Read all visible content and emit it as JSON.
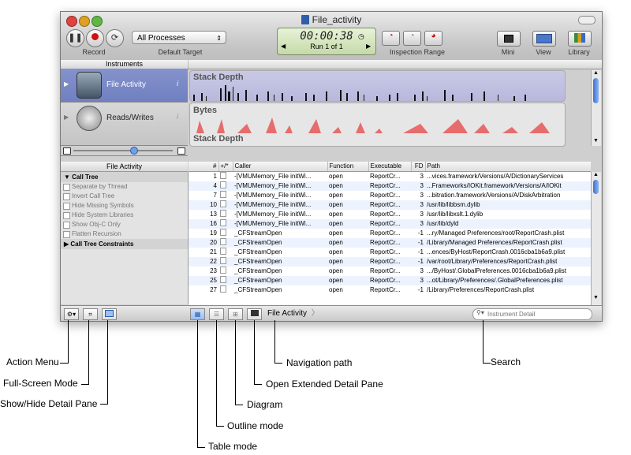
{
  "window": {
    "title": "File_activity"
  },
  "toolbar": {
    "record_label": "Record",
    "target_label": "Default Target",
    "process_select": "All Processes",
    "timer": "00:00:38",
    "run_label": "Run 1 of 1",
    "inspection_label": "Inspection Range",
    "mini_label": "Mini",
    "view_label": "View",
    "library_label": "Library"
  },
  "instruments": {
    "header": "Instruments",
    "tracks": [
      {
        "name": "File Activity",
        "graph_labels": [
          "Stack Depth"
        ],
        "selected": true
      },
      {
        "name": "Reads/Writes",
        "graph_labels": [
          "Bytes",
          "Stack Depth"
        ],
        "selected": false
      }
    ]
  },
  "detail": {
    "sidebar_title": "File Activity",
    "call_tree_label": "Call Tree",
    "options": [
      "Separate by Thread",
      "Invert Call Tree",
      "Hide Missing Symbols",
      "Hide System Libraries",
      "Show Obj-C Only",
      "Flatten Recursion"
    ],
    "constraints_label": "Call Tree Constraints",
    "columns": [
      "#",
      "+/*",
      "Caller",
      "Function",
      "Executable",
      "FD",
      "Path"
    ],
    "rows": [
      {
        "n": "1",
        "caller": "-[VMUMemory_File initWi...",
        "function": "open",
        "executable": "ReportCr...",
        "fd": "3",
        "path": "...vices.framework/Versions/A/DictionaryServices"
      },
      {
        "n": "4",
        "caller": "-[VMUMemory_File initWi...",
        "function": "open",
        "executable": "ReportCr...",
        "fd": "3",
        "path": "...Frameworks/IOKit.framework/Versions/A/IOKit"
      },
      {
        "n": "7",
        "caller": "-[VMUMemory_File initWi...",
        "function": "open",
        "executable": "ReportCr...",
        "fd": "3",
        "path": "...bitration.framework/Versions/A/DiskArbitration"
      },
      {
        "n": "10",
        "caller": "-[VMUMemory_File initWi...",
        "function": "open",
        "executable": "ReportCr...",
        "fd": "3",
        "path": "/usr/lib/libbsm.dylib"
      },
      {
        "n": "13",
        "caller": "-[VMUMemory_File initWi...",
        "function": "open",
        "executable": "ReportCr...",
        "fd": "3",
        "path": "/usr/lib/libxslt.1.dylib"
      },
      {
        "n": "16",
        "caller": "-[VMUMemory_File initWi...",
        "function": "open",
        "executable": "ReportCr...",
        "fd": "3",
        "path": "/usr/lib/dyld"
      },
      {
        "n": "19",
        "caller": "_CFStreamOpen",
        "function": "open",
        "executable": "ReportCr...",
        "fd": "-1",
        "path": "...ry/Managed Preferences/root/ReportCrash.plist"
      },
      {
        "n": "20",
        "caller": "_CFStreamOpen",
        "function": "open",
        "executable": "ReportCr...",
        "fd": "-1",
        "path": "/Library/Managed Preferences/ReportCrash.plist"
      },
      {
        "n": "21",
        "caller": "_CFStreamOpen",
        "function": "open",
        "executable": "ReportCr...",
        "fd": "-1",
        "path": "...ences/ByHost/ReportCrash.0016cba1b6a9.plist"
      },
      {
        "n": "22",
        "caller": "_CFStreamOpen",
        "function": "open",
        "executable": "ReportCr...",
        "fd": "-1",
        "path": "/var/root/Library/Preferences/ReportCrash.plist"
      },
      {
        "n": "23",
        "caller": "_CFStreamOpen",
        "function": "open",
        "executable": "ReportCr...",
        "fd": "3",
        "path": ".../ByHost/.GlobalPreferences.0016cba1b6a9.plist"
      },
      {
        "n": "25",
        "caller": "_CFStreamOpen",
        "function": "open",
        "executable": "ReportCr...",
        "fd": "3",
        "path": "...ot/Library/Preferences/.GlobalPreferences.plist"
      },
      {
        "n": "27",
        "caller": "_CFStreamOpen",
        "function": "open",
        "executable": "ReportCr...",
        "fd": "-1",
        "path": "/Library/Preferences/ReportCrash.plist"
      }
    ]
  },
  "bottom": {
    "nav_path": "File Activity",
    "search_placeholder": "Instrument Detail"
  },
  "callouts": {
    "action_menu": "Action Menu",
    "full_screen": "Full-Screen Mode",
    "show_hide": "Show/Hide Detail Pane",
    "table_mode": "Table mode",
    "outline_mode": "Outline mode",
    "diagram": "Diagram",
    "extended_detail": "Open Extended Detail Pane",
    "navigation_path": "Navigation path",
    "search": "Search"
  },
  "icons": [
    "pause-icon",
    "record-icon",
    "loop-icon",
    "gear-icon",
    "fullscreen-icon",
    "detail-pane-icon",
    "table-mode-icon",
    "outline-mode-icon",
    "diagram-icon",
    "extended-detail-icon",
    "search-icon"
  ]
}
